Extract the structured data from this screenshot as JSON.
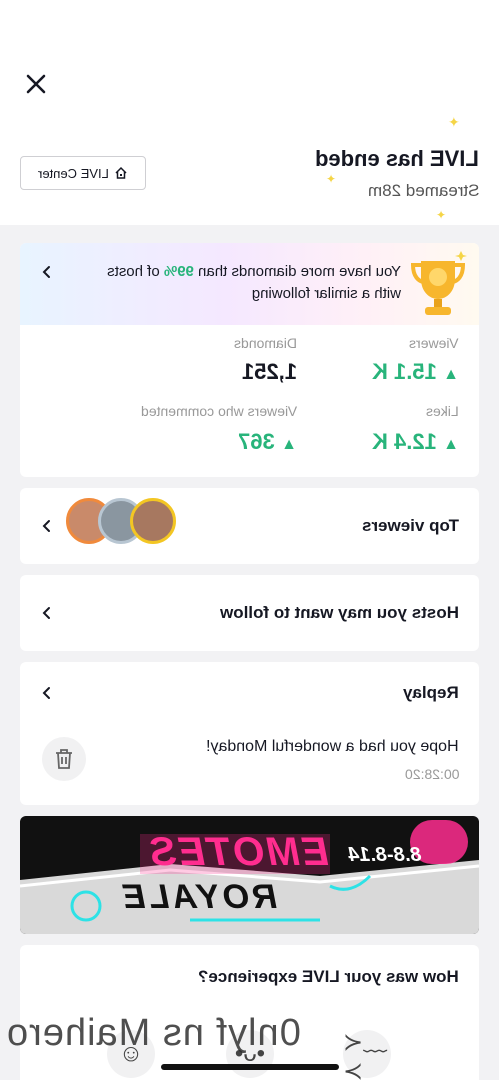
{
  "header": {
    "title": "LIVE has ended",
    "subtitle": "Streamed 28m",
    "live_center_label": "LIVE Center"
  },
  "stats": {
    "banner_text_prefix": "You have more diamonds than",
    "banner_highlight": "99%",
    "banner_text_suffix": "of hosts with a similar following",
    "items": [
      {
        "label": "Viewers",
        "value": "15.1 K"
      },
      {
        "label": "Diamonds",
        "value": "1,251"
      },
      {
        "label": "Likes",
        "value": "12.4 K"
      },
      {
        "label": "Viewers who commented",
        "value": "367"
      }
    ]
  },
  "top_viewers": {
    "label": "Top viewers"
  },
  "hosts": {
    "label": "Hosts you may want to follow"
  },
  "replay": {
    "label": "Replay",
    "item_title": "Hope you had a wonderful Monday!",
    "item_duration": "00:28:20"
  },
  "promo": {
    "line1": "EMOTES",
    "line2": "ROYALE",
    "date": "8.8-8.14"
  },
  "experience": {
    "question": "How was your LIVE experience?"
  },
  "watermark": "0nlyf ns Maihero",
  "colors": {
    "accent_green": "#28b47b",
    "spark_yellow": "#f5d547",
    "promo_pink": "#ff2d8f",
    "promo_cyan": "#2de2e6"
  }
}
